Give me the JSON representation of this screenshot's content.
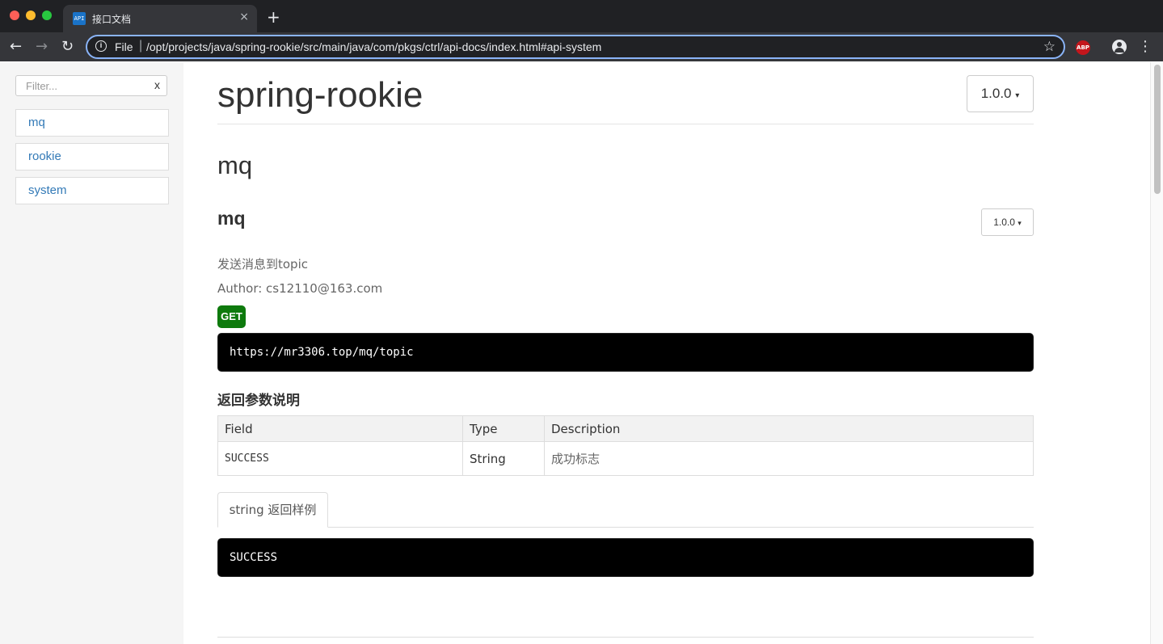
{
  "browser": {
    "tab_title": "接口文档",
    "tab_favicon": "API",
    "tab_close": "×",
    "new_tab": "+",
    "url_scheme": "File",
    "url_separator": "|",
    "url": "/opt/projects/java/spring-rookie/src/main/java/com/pkgs/ctrl/api-docs/index.html#api-system",
    "extension_label": "ABP",
    "icons": {
      "back": "←",
      "forward": "→",
      "reload": "↻",
      "info": "i",
      "bookmark": "☆",
      "menu": "⋮"
    }
  },
  "sidebar": {
    "filter_placeholder": "Filter...",
    "filter_clear": "x",
    "items": [
      {
        "label": "mq"
      },
      {
        "label": "rookie"
      },
      {
        "label": "system"
      }
    ]
  },
  "main": {
    "title": "spring-rookie",
    "version": "1.0.0",
    "group": "mq",
    "api": {
      "name": "mq",
      "version": "1.0.0",
      "description": "发送消息到topic",
      "author": "Author: cs12110@163.com",
      "method": "GET",
      "url": "https://mr3306.top/mq/topic",
      "params_title": "返回参数说明",
      "table": {
        "headers": [
          "Field",
          "Type",
          "Description"
        ],
        "rows": [
          {
            "field": "SUCCESS",
            "type": "String",
            "description": "成功标志"
          }
        ]
      },
      "sample_tab": "string 返回样例",
      "sample": "SUCCESS"
    }
  },
  "colors": {
    "link": "#337ab7",
    "method_get": "#0e7a0d",
    "code_bg": "#000000",
    "omnibox_focus": "#8ab4f8"
  }
}
